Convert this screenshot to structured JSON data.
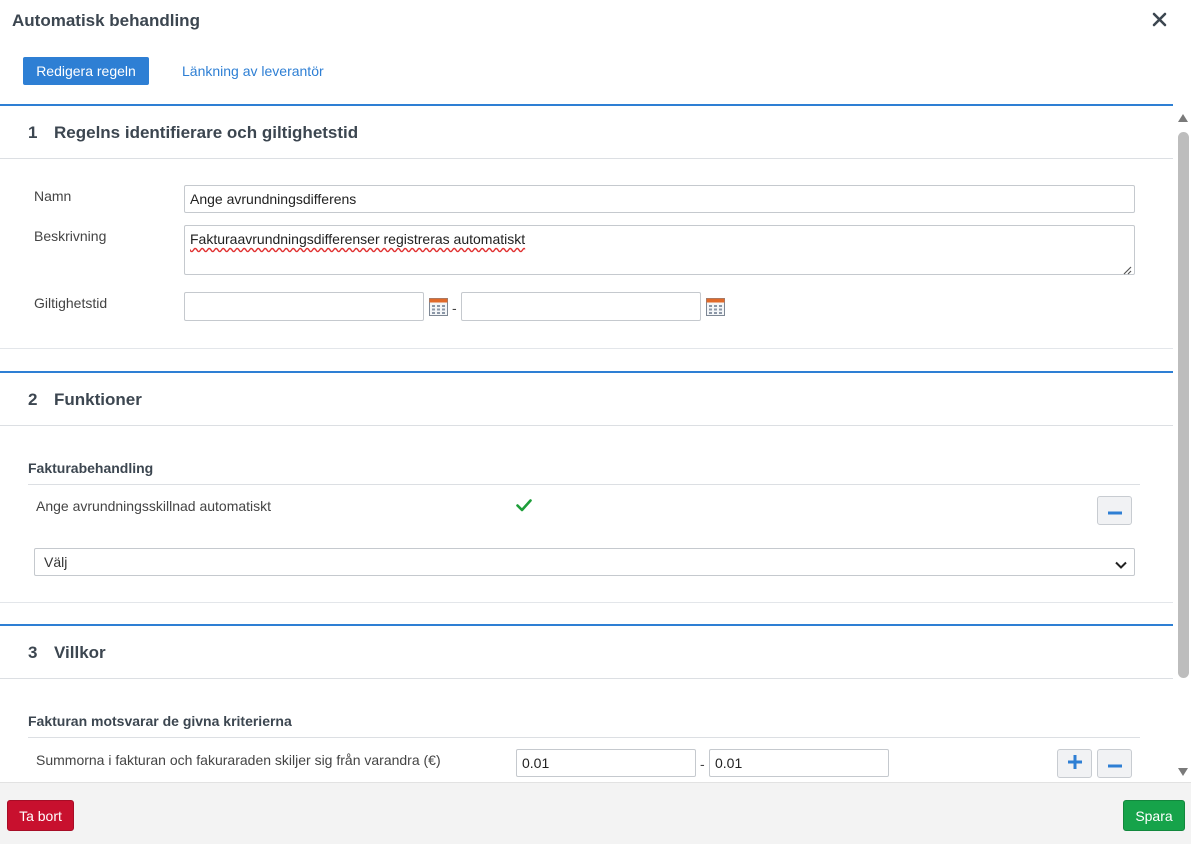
{
  "window": {
    "title": "Automatisk behandling",
    "close_icon": "close-icon"
  },
  "tabs": [
    {
      "label": "Redigera regeln",
      "active": true
    },
    {
      "label": "Länkning av leverantör",
      "active": false
    }
  ],
  "section1": {
    "number": "1",
    "title": "Regelns identifierare och giltighetstid",
    "name_label": "Namn",
    "name_value": "Ange avrundningsdifferens",
    "description_label": "Beskrivning",
    "description_value": "Fakturaavrundningsdifferenser registreras automatiskt",
    "validity_label": "Giltighetstid",
    "validity_from": "",
    "validity_to": "",
    "range_separator": "-",
    "calendar_icon": "calendar-icon"
  },
  "section2": {
    "number": "2",
    "title": "Funktioner",
    "group_title": "Fakturabehandling",
    "function_label": "Ange avrundningsskillnad automatiskt",
    "function_enabled_icon": "checkmark-icon",
    "select_value": "Välj"
  },
  "section3": {
    "number": "3",
    "title": "Villkor",
    "group_title": "Fakturan motsvarar de givna kriterierna",
    "condition_label": "Summorna i fakturan och fakuraraden skiljer sig från varandra (€)",
    "condition_from": "0.01",
    "condition_to": "0.01",
    "range_separator": "-"
  },
  "footer": {
    "delete_label": "Ta bort",
    "save_label": "Spara"
  },
  "colors": {
    "accent": "#2e7fd4",
    "delete": "#c8102e",
    "save": "#16a34a",
    "check": "#1e9e3a"
  }
}
